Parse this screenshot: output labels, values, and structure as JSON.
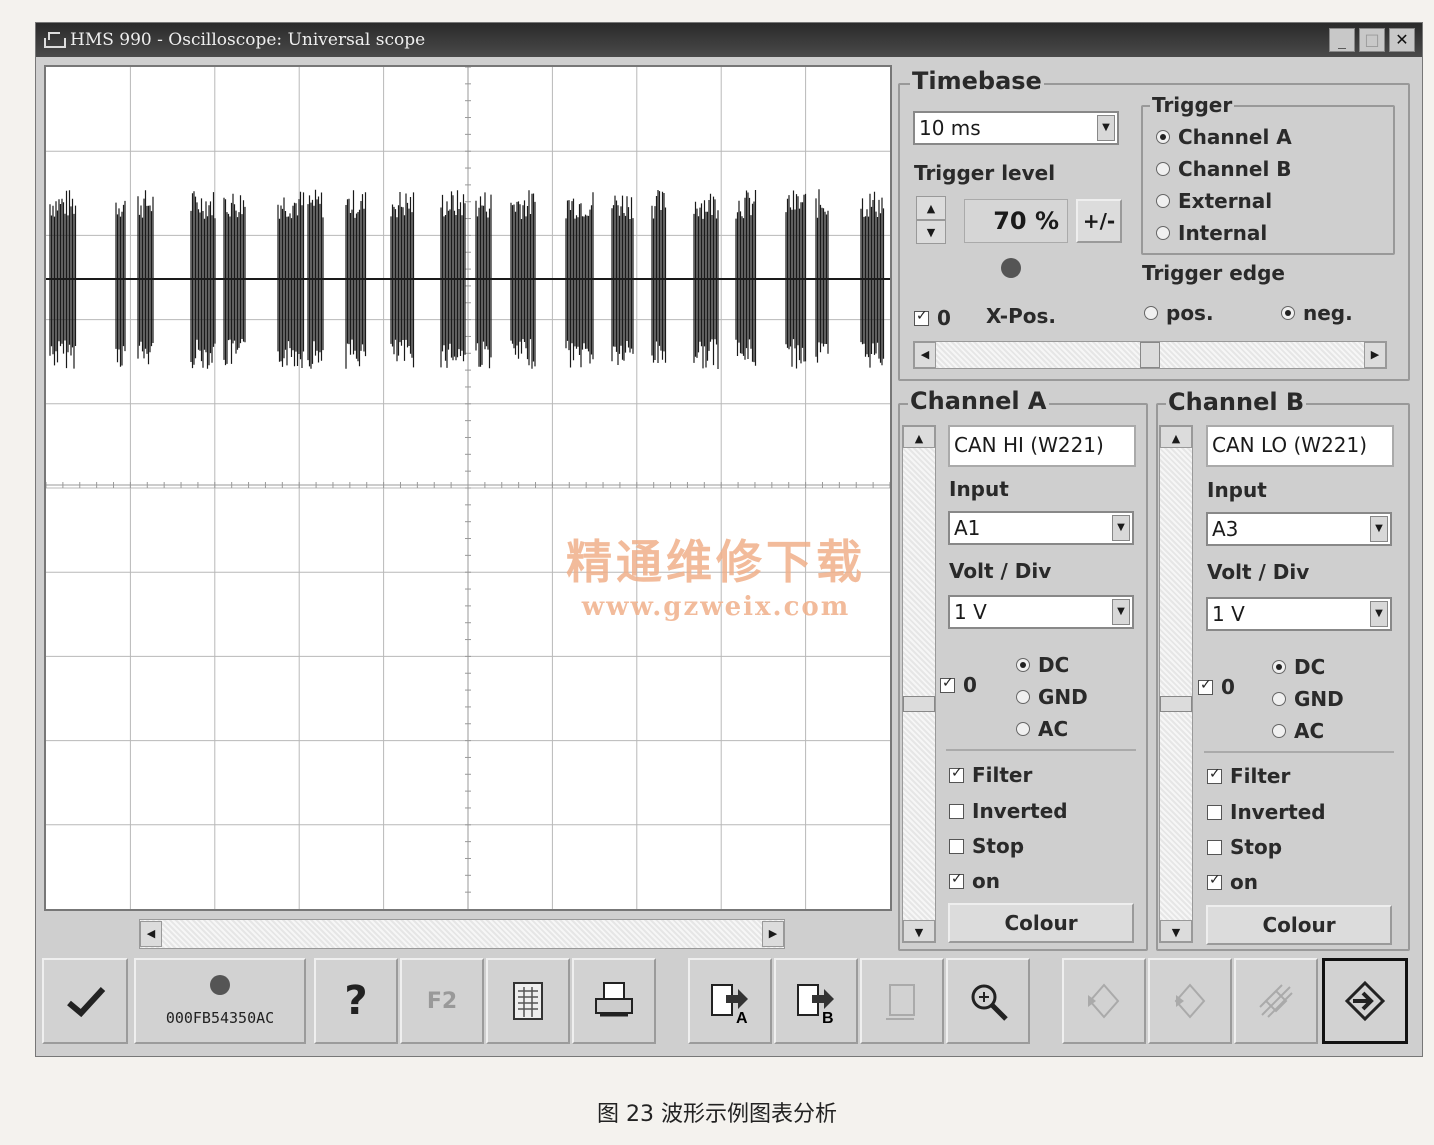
{
  "window": {
    "title": "HMS 990 - Oscilloscope: Universal scope",
    "minimize_label": "_",
    "maximize_label": "□",
    "close_label": "✕"
  },
  "timebase": {
    "title": "Timebase",
    "value": "10 ms",
    "trigger_level_label": "Trigger level",
    "trigger_level_value": "70 %",
    "plus_minus_label": "+/-",
    "xpos_check_label": "0",
    "xpos_label": "X-Pos.",
    "xpos_checked": true
  },
  "trigger": {
    "title": "Trigger",
    "options": [
      "Channel A",
      "Channel B",
      "External",
      "Internal"
    ],
    "selected": "Channel A",
    "edge_label": "Trigger edge",
    "edge_options": [
      "pos.",
      "neg."
    ],
    "edge_selected": "neg."
  },
  "channel_a": {
    "title": "Channel A",
    "name": "CAN HI (W221)",
    "input_label": "Input",
    "input_value": "A1",
    "volt_label": "Volt / Div",
    "volt_value": "1 V",
    "zero_label": "0",
    "coupling": [
      "DC",
      "GND",
      "AC"
    ],
    "coupling_selected": "DC",
    "filter_label": "Filter",
    "filter": true,
    "inverted_label": "Inverted",
    "inverted": false,
    "stop_label": "Stop",
    "stop": false,
    "on_label": "on",
    "on": true,
    "colour_label": "Colour"
  },
  "channel_b": {
    "title": "Channel B",
    "name": "CAN LO (W221)",
    "input_label": "Input",
    "input_value": "A3",
    "volt_label": "Volt / Div",
    "volt_value": "1 V",
    "zero_label": "0",
    "coupling": [
      "DC",
      "GND",
      "AC"
    ],
    "coupling_selected": "DC",
    "filter_label": "Filter",
    "filter": true,
    "inverted_label": "Inverted",
    "inverted": false,
    "stop_label": "Stop",
    "stop": false,
    "on_label": "on",
    "on": true,
    "colour_label": "Colour"
  },
  "toolbar": {
    "device_id": "000FB54350AC",
    "help_label": "?",
    "f2_label": "F2",
    "icons": [
      "checkmark-icon",
      "status-led-icon",
      "help-icon",
      "f2-key-icon",
      "data-sheet-icon",
      "print-icon",
      "channel-a-export-icon",
      "channel-b-export-icon",
      "blank-page-icon",
      "zoom-icon",
      "arrow-left-icon",
      "arrow-right-icon",
      "crossed-out-icon",
      "exit-arrow-icon"
    ]
  },
  "watermark": {
    "line1": "精通维修下载",
    "line2": "www.gzweix.com"
  },
  "caption": "图 23  波形示例图表分析",
  "colors": {
    "window_bg": "#cfcfcf",
    "scope_bg": "#ffffff",
    "trace": "#1a1a1a",
    "watermark": "#f0b08a"
  }
}
